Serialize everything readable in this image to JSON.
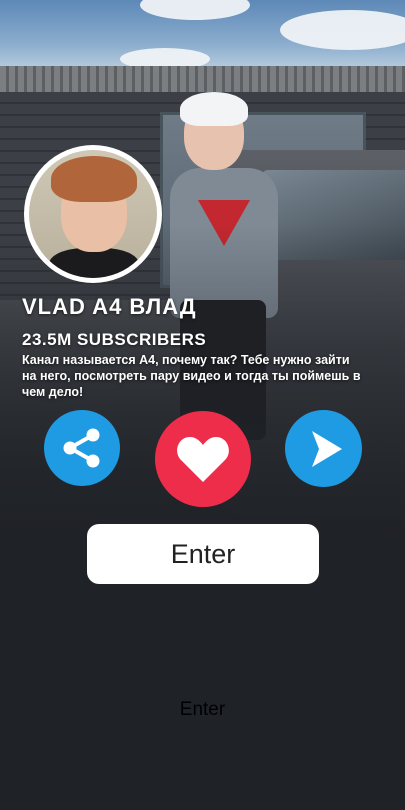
{
  "profile": {
    "name": "VLAD A4 ВЛАД",
    "subscribers": "23.5M SUBSCRIBERS",
    "description": "Канал называется А4, почему так? Тебе нужно зайти на него, посмотреть пару видео и тогда ты поймешь в чем дело!"
  },
  "actions": {
    "share_icon": "share-icon",
    "like_icon": "heart-icon",
    "play_icon": "play-icon"
  },
  "enter": {
    "button_label": "Enter",
    "link_label": "Enter"
  },
  "colors": {
    "blue": "#1e9be3",
    "red": "#ee2d4a",
    "background": "#1f2227"
  }
}
